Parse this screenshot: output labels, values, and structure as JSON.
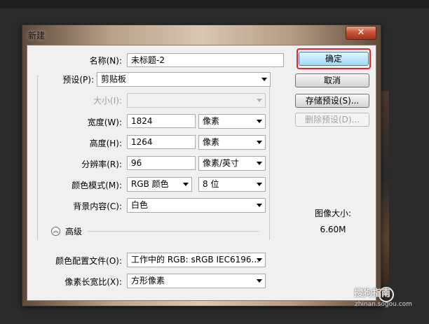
{
  "window": {
    "title": "新建",
    "close_glyph": "✕"
  },
  "form": {
    "name": {
      "label": "名称(N):",
      "value": "未标题-2"
    },
    "preset": {
      "label": "预设(P):",
      "value": "剪贴板"
    },
    "size": {
      "label": "大小(I):",
      "value": ""
    },
    "width": {
      "label": "宽度(W):",
      "value": "1824",
      "unit": "像素"
    },
    "height": {
      "label": "高度(H):",
      "value": "1264",
      "unit": "像素"
    },
    "resolution": {
      "label": "分辨率(R):",
      "value": "96",
      "unit": "像素/英寸"
    },
    "color_mode": {
      "label": "颜色模式(M):",
      "value": "RGB 颜色",
      "bits": "8 位"
    },
    "background": {
      "label": "背景内容(C):",
      "value": "白色"
    },
    "advanced": {
      "label": "高级",
      "icon": "double-chevron-up-icon",
      "glyph": "︽"
    },
    "color_profile": {
      "label": "颜色配置文件(O):",
      "value": "工作中的 RGB: sRGB IEC6196..."
    },
    "pixel_aspect": {
      "label": "像素长宽比(X):",
      "value": "方形像素"
    }
  },
  "buttons": {
    "ok": "确定",
    "cancel": "取消",
    "save_preset": "存储预设(S)...",
    "delete_preset": "删除预设(D)..."
  },
  "image_size": {
    "label": "图像大小:",
    "value": "6.60M"
  },
  "watermark": {
    "text": "搜狗指南",
    "sub": "zhinan.sogou.com"
  },
  "colors": {
    "highlight": "#e0262a",
    "default_button": "#bee6fd"
  }
}
